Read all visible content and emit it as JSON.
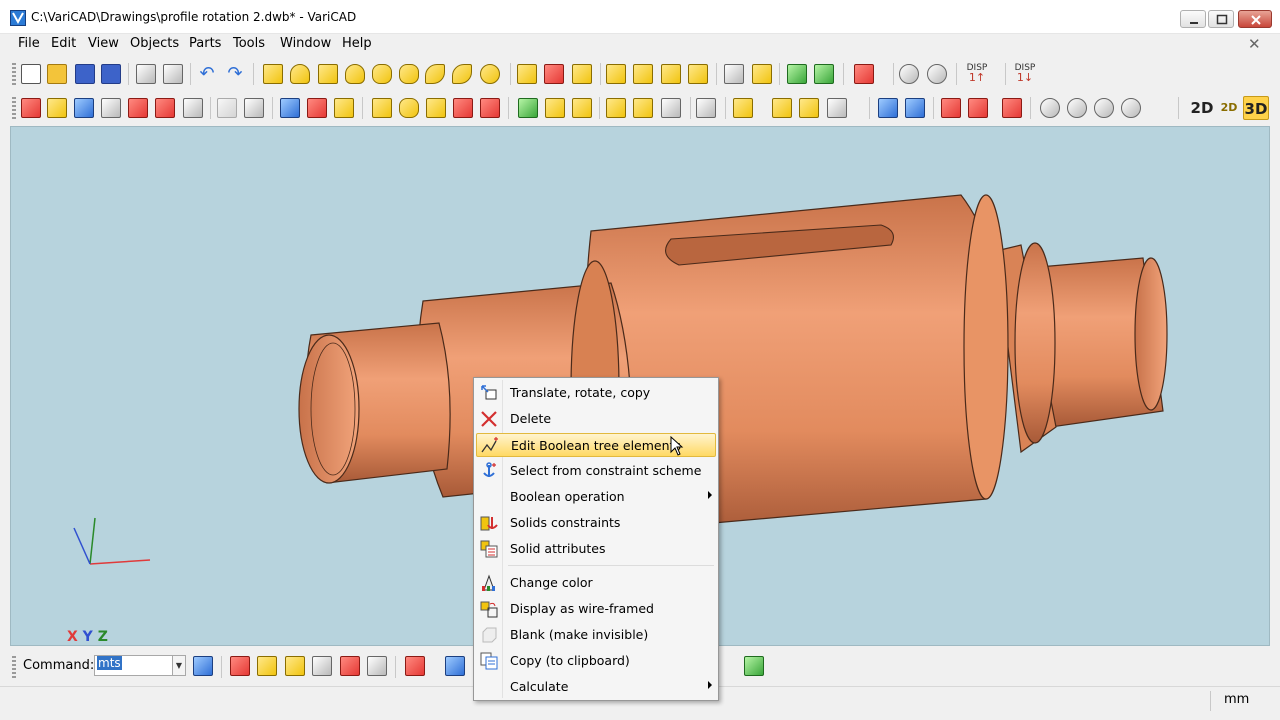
{
  "window": {
    "title": "C:\\VariCAD\\Drawings\\profile rotation 2.dwb* - VariCAD"
  },
  "menubar": {
    "items": [
      "File",
      "Edit",
      "View",
      "Objects",
      "Parts",
      "Tools",
      "Window",
      "Help"
    ],
    "close_glyph": "✕"
  },
  "toolbar1": {
    "disp_buttons": [
      {
        "top": "DISP",
        "bottom": "1↑"
      },
      {
        "top": "DISP",
        "bottom": "1↓"
      }
    ]
  },
  "toolbar2": {
    "view_buttons": [
      "2D",
      "2D",
      "3D"
    ]
  },
  "viewport": {
    "axis_label": {
      "x": "X",
      "y": "Y",
      "z": "Z"
    },
    "background_color": "#b7d3dd",
    "part_color": "#e08a5a"
  },
  "command_bar": {
    "label": "Command:",
    "input_value": "mts"
  },
  "status_bar": {
    "unit": "mm"
  },
  "context_menu": {
    "items": [
      {
        "label": "Translate, rotate, copy",
        "icon": "translate-icon"
      },
      {
        "label": "Delete",
        "icon": "delete-icon"
      },
      {
        "label": "Edit Boolean tree elements",
        "icon": "boolean-tree-icon",
        "highlighted": true
      },
      {
        "label": "Select from constraint scheme",
        "icon": "constraint-anchor-icon"
      },
      {
        "label": "Boolean operation",
        "submenu": true
      },
      {
        "label": "Solids constraints",
        "icon": "solids-constraints-icon"
      },
      {
        "label": "Solid attributes",
        "icon": "solid-attributes-icon"
      },
      {
        "label": "Change color",
        "icon": "change-color-icon"
      },
      {
        "label": "Display as wire-framed",
        "icon": "wireframe-icon"
      },
      {
        "label": "Blank (make invisible)",
        "icon": "blank-icon"
      },
      {
        "label": "Copy (to clipboard)",
        "icon": "clipboard-icon"
      },
      {
        "label": "Calculate",
        "submenu": true
      }
    ]
  }
}
